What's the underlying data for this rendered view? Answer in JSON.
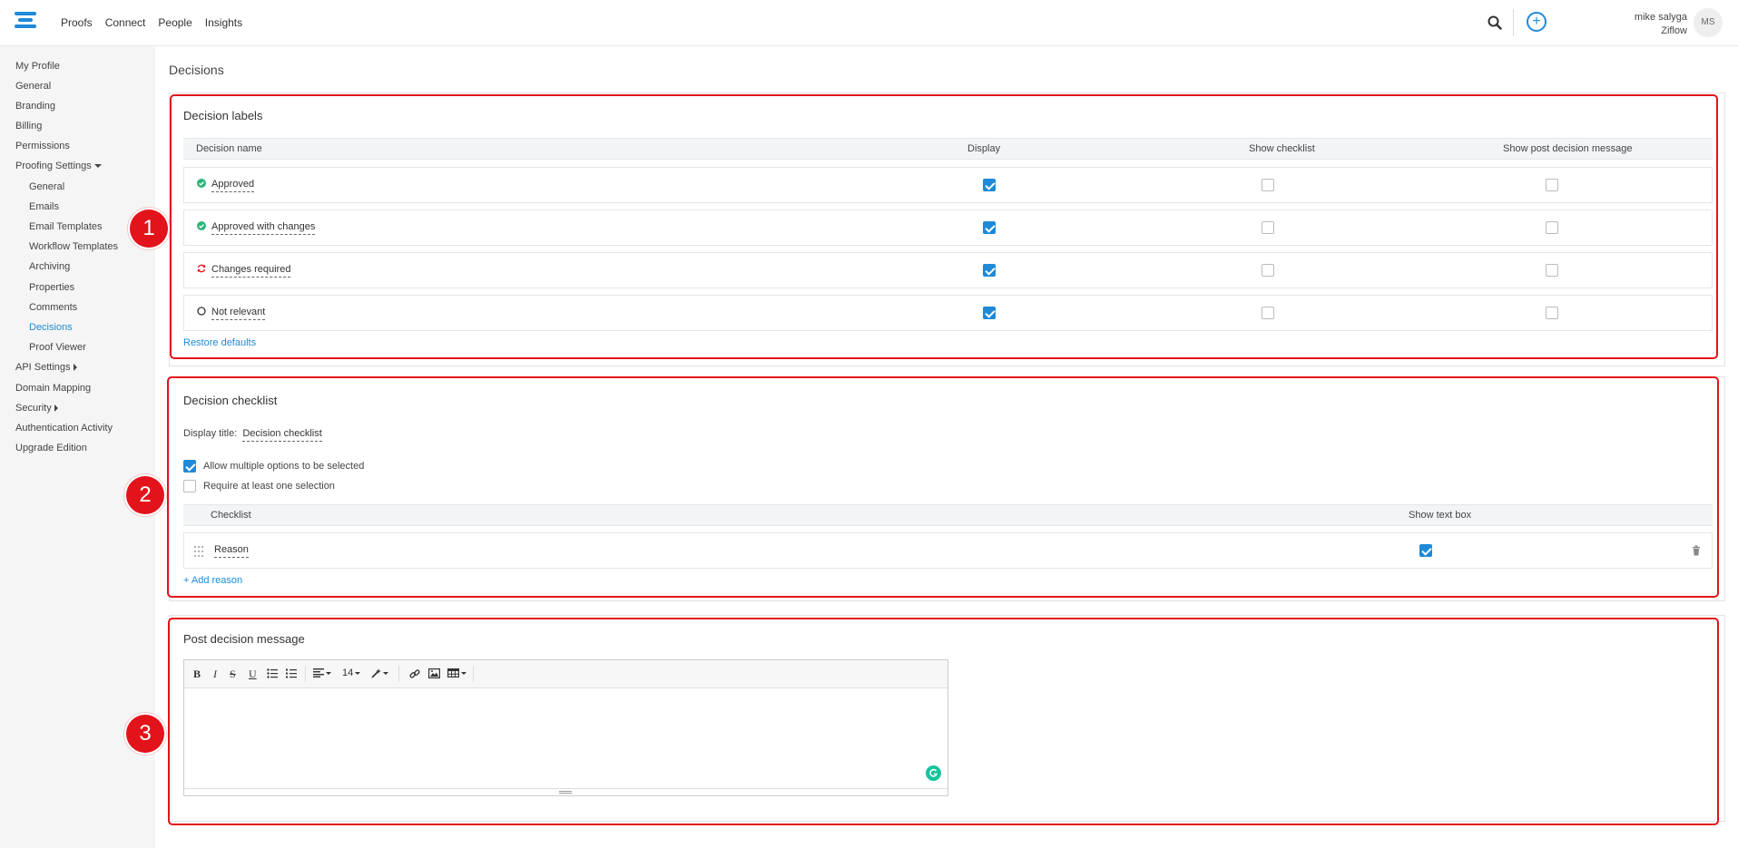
{
  "topbar": {
    "nav": [
      "Proofs",
      "Connect",
      "People",
      "Insights"
    ],
    "user_name": "mike salyga",
    "org": "Ziflow",
    "avatar_initials": "MS",
    "plus": "+"
  },
  "sidebar": {
    "items": [
      {
        "label": "My Profile"
      },
      {
        "label": "General"
      },
      {
        "label": "Branding"
      },
      {
        "label": "Billing"
      },
      {
        "label": "Permissions"
      },
      {
        "label": "Proofing Settings"
      },
      {
        "label": "General"
      },
      {
        "label": "Emails"
      },
      {
        "label": "Email Templates"
      },
      {
        "label": "Workflow Templates"
      },
      {
        "label": "Archiving"
      },
      {
        "label": "Properties"
      },
      {
        "label": "Comments"
      },
      {
        "label": "Decisions"
      },
      {
        "label": "Proof Viewer"
      },
      {
        "label": "API Settings"
      },
      {
        "label": "Domain Mapping"
      },
      {
        "label": "Security"
      },
      {
        "label": "Authentication Activity"
      },
      {
        "label": "Upgrade Edition"
      }
    ]
  },
  "page_title": "Decisions",
  "labels_section": {
    "title": "Decision labels",
    "columns": [
      "Decision name",
      "Display",
      "Show checklist",
      "Show post decision message"
    ],
    "rows": [
      {
        "name": "Approved",
        "icon": "check-circle-icon",
        "color": "#2bb57a",
        "display": true,
        "show_checklist": false,
        "show_post": false
      },
      {
        "name": "Approved with changes",
        "icon": "check-circle-icon",
        "color": "#2bb57a",
        "display": true,
        "show_checklist": false,
        "show_post": false
      },
      {
        "name": "Changes required",
        "icon": "refresh-icon",
        "color": "#e3131b",
        "display": true,
        "show_checklist": false,
        "show_post": false
      },
      {
        "name": "Not relevant",
        "icon": "circle-outline-icon",
        "color": "#333333",
        "display": true,
        "show_checklist": false,
        "show_post": false
      }
    ],
    "restore_label": "Restore defaults"
  },
  "checklist_section": {
    "title": "Decision checklist",
    "display_title_label": "Display title:",
    "display_title_value": "Decision checklist",
    "allow_multiple_label": "Allow multiple options to be selected",
    "allow_multiple": true,
    "require_one_label": "Require at least one selection",
    "require_one": false,
    "columns": [
      "Checklist",
      "Show text box"
    ],
    "rows": [
      {
        "name": "Reason",
        "show_text_box": true
      }
    ],
    "add_label": "+ Add reason"
  },
  "post_section": {
    "title": "Post decision message",
    "font_size": "14"
  },
  "badges": [
    "1",
    "2",
    "3"
  ],
  "colors": {
    "accent": "#1e8ad8",
    "highlight": "#e3131b",
    "success": "#2bb57a"
  }
}
